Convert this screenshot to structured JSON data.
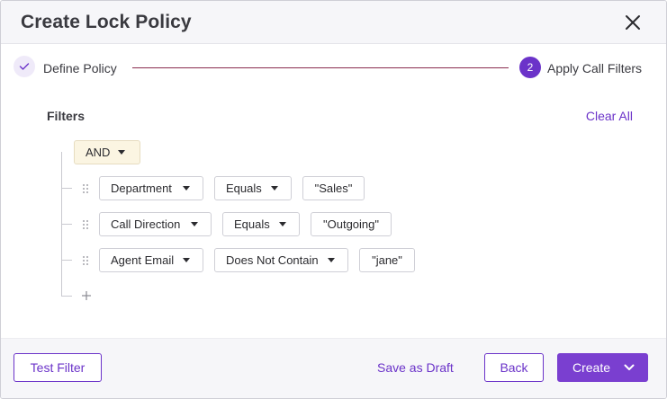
{
  "dialog": {
    "title": "Create Lock Policy"
  },
  "stepper": {
    "steps": [
      {
        "label": "Define Policy",
        "state": "done"
      },
      {
        "number": "2",
        "label": "Apply Call Filters",
        "state": "active"
      }
    ]
  },
  "filters": {
    "heading": "Filters",
    "clear_all": "Clear All",
    "operator": "AND",
    "rows": [
      {
        "field": "Department",
        "condition": "Equals",
        "value": "\"Sales\""
      },
      {
        "field": "Call Direction",
        "condition": "Equals",
        "value": "\"Outgoing\""
      },
      {
        "field": "Agent Email",
        "condition": "Does Not Contain",
        "value": "\"jane\""
      }
    ]
  },
  "footer": {
    "test_filter": "Test Filter",
    "save_draft": "Save as Draft",
    "back": "Back",
    "create": "Create"
  },
  "colors": {
    "accent": "#6b33c9",
    "primary_button": "#7a3fd0",
    "step_line": "#8a2c4e",
    "operator_bg": "#fbf5e2"
  },
  "icons": {
    "close": "close-icon",
    "step_done": "check-icon",
    "drag": "drag-handle-icon",
    "dropdown": "caret-down-icon",
    "add": "plus-icon",
    "create_menu": "chevron-down-icon"
  }
}
